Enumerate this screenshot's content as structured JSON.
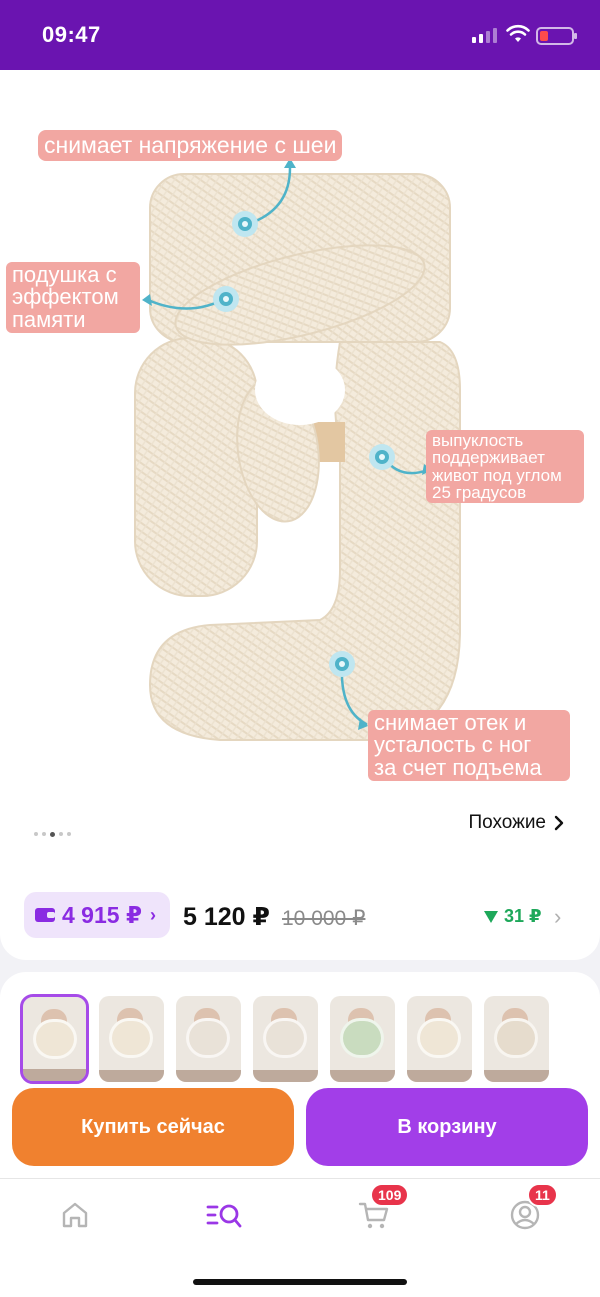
{
  "status_bar": {
    "time": "09:47",
    "battery_color": "#ff4b4b",
    "background": "#6a14b0"
  },
  "hero": {
    "icons": [
      "chevron-left-icon",
      "heart-icon",
      "share-icon"
    ],
    "callouts": {
      "neck": "снимает напряжение с шеи",
      "memory": "подушка с\nэффектом\nпамяти",
      "belly": "выпуклость\nподдерживает\nживот под углом\n25 градусов",
      "legs": "снимает отек и\nусталость с ног\nза счет подъема"
    },
    "carousel": {
      "count": 5,
      "active_index": 2
    },
    "similar_label": "Похожие"
  },
  "price": {
    "wallet_price": "4 915 ₽",
    "current": "5 120 ₽",
    "old": "10 000 ₽",
    "cashback": "31 ₽",
    "accent": "#8a2be2",
    "cashback_color": "#1ea85a"
  },
  "variants": {
    "selected_index": 0,
    "items": [
      {
        "pillow": "#efe6d6"
      },
      {
        "pillow": "#efe6d6"
      },
      {
        "pillow": "#e9e2d8"
      },
      {
        "pillow": "#e9e2d8"
      },
      {
        "pillow": "#c9dcbf"
      },
      {
        "pillow": "#efe6d6"
      },
      {
        "pillow": "#e6dccd"
      }
    ]
  },
  "actions": {
    "buy_now": "Купить сейчас",
    "add_to_cart": "В корзину",
    "buy_color": "#f0812f",
    "cart_color": "#a23ee8"
  },
  "tabbar": {
    "items": [
      {
        "name": "home",
        "icon": "home-icon"
      },
      {
        "name": "catalog",
        "icon": "catalog-search-icon",
        "active": true
      },
      {
        "name": "cart",
        "icon": "cart-icon",
        "badge": "109"
      },
      {
        "name": "profile",
        "icon": "profile-icon",
        "badge": "11"
      }
    ]
  }
}
